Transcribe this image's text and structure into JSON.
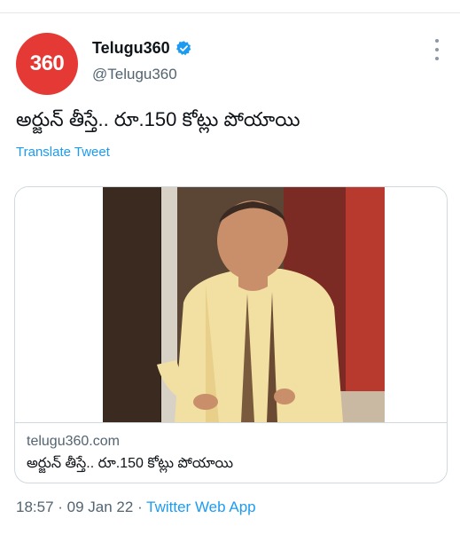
{
  "account": {
    "avatar_text": "360",
    "display_name": "Telugu360",
    "handle": "@Telugu360",
    "verified": true
  },
  "tweet": {
    "text": "అర్జున్ తీస్తే.. రూ.150 కోట్లు పోయాయి",
    "translate_label": "Translate Tweet"
  },
  "card": {
    "domain": "telugu360.com",
    "title": "అర్జున్ తీస్తే.. రూ.150 కోట్లు పోయాయి"
  },
  "meta": {
    "time": "18:57",
    "sep1": " · ",
    "date": "09 Jan 22",
    "sep2": " · ",
    "source": "Twitter Web App"
  },
  "icons": {
    "verified": "verified-badge-icon",
    "more": "more-options-icon"
  },
  "colors": {
    "link": "#1d9bf0",
    "avatar_bg": "#e53935",
    "secondary_text": "#536471",
    "border": "#cfd9de"
  }
}
